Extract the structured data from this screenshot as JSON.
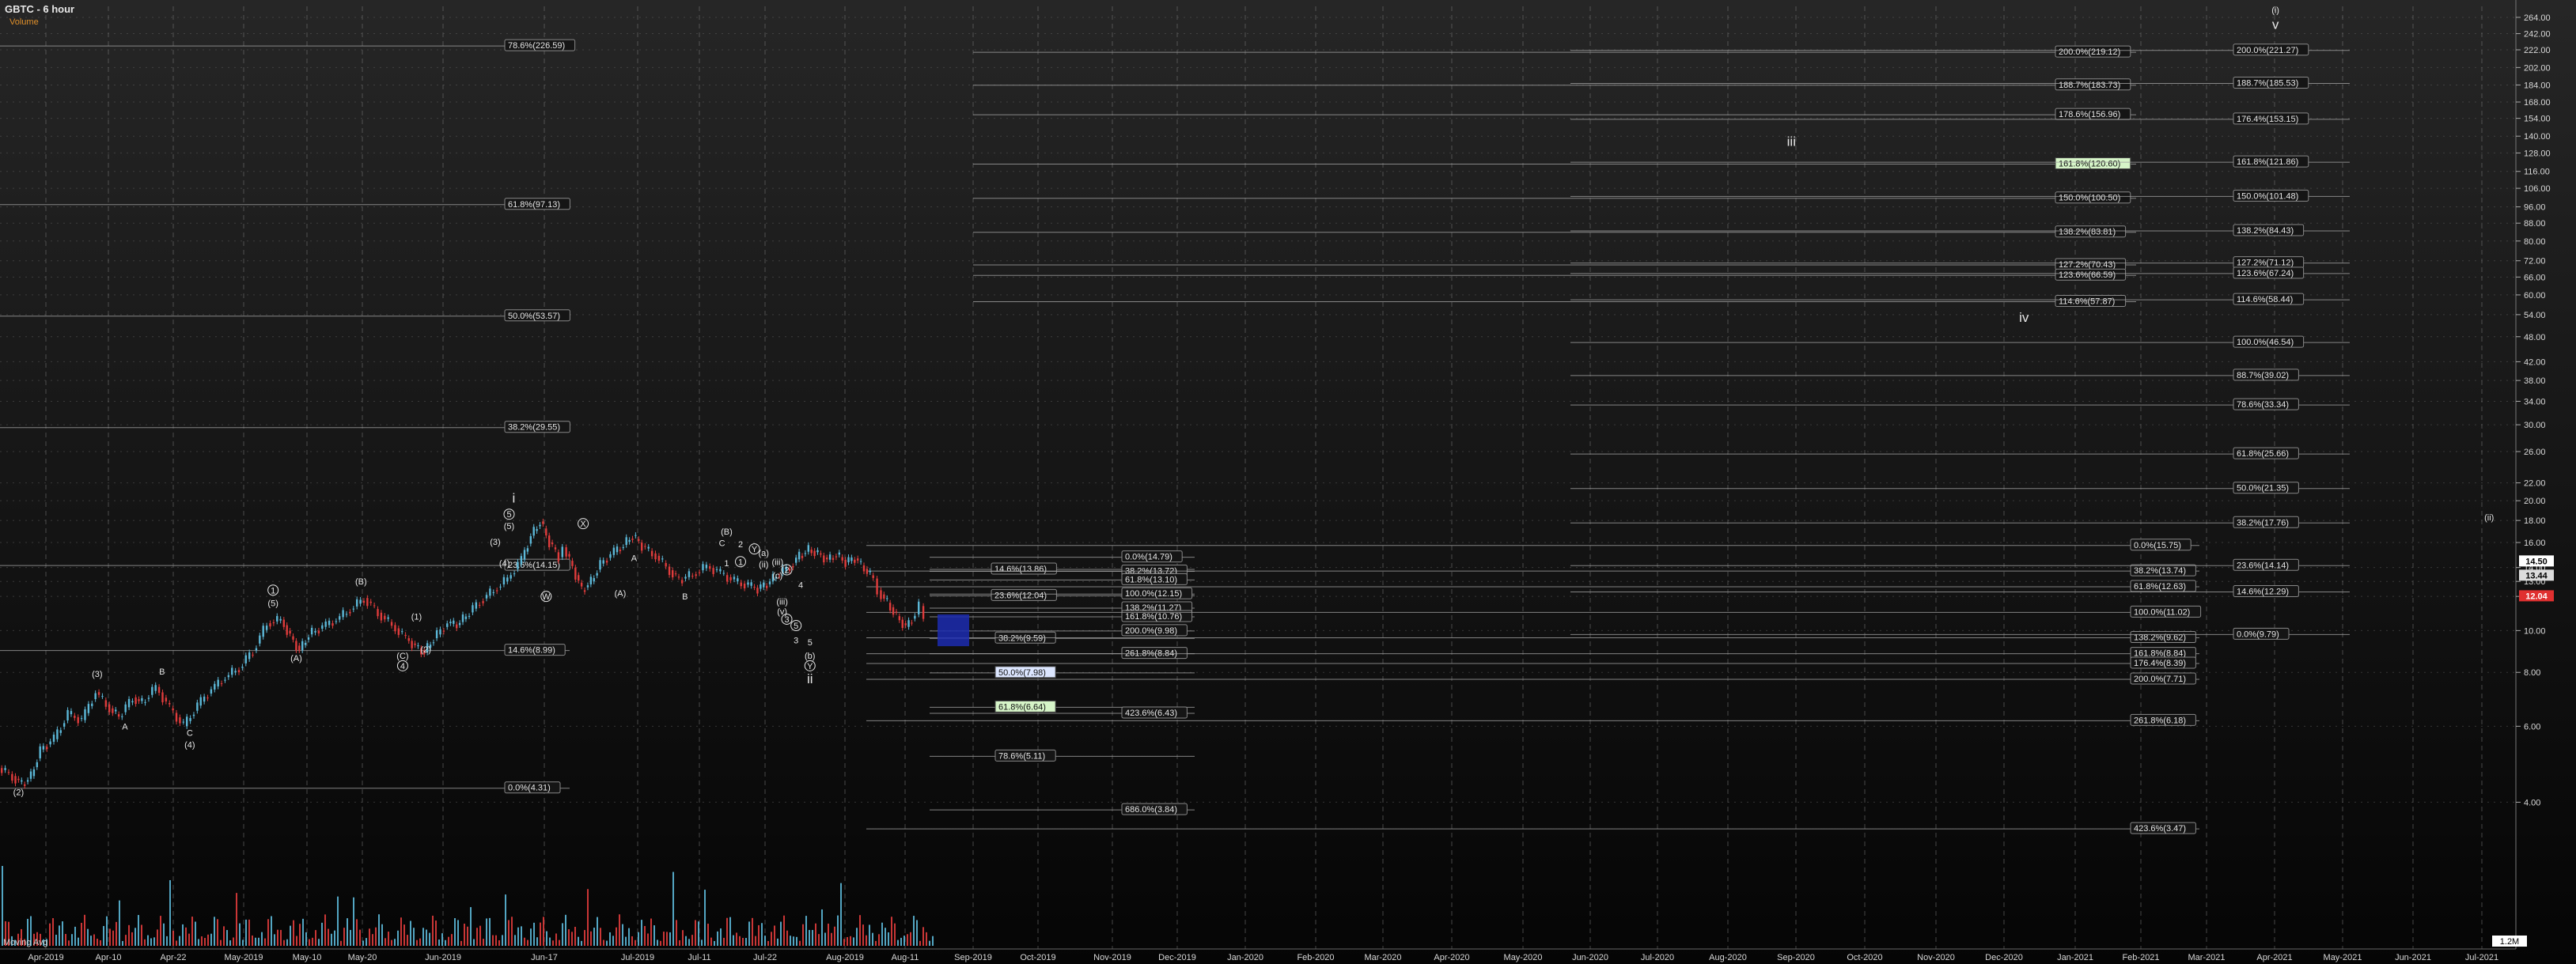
{
  "chart_data": {
    "type": "line",
    "title": "GBTC - 6 hour",
    "subtitle": "Volume",
    "volume_label": "Moving Avg",
    "volume_axis_label": "1.2M",
    "yscale": "log",
    "ylim": [
      3.3,
      280
    ],
    "grid": true,
    "colors": {
      "up": "#5cb8d8",
      "down": "#e03c3c",
      "bg_top": "#232323",
      "bg_bottom": "#050505",
      "fib_line": "#9a9a9a",
      "text": "#e6e6e6",
      "highlight_box": "#1c2cb0"
    },
    "x_labels": [
      "Apr-2019",
      "Apr-10",
      "Apr-22",
      "May-2019",
      "May-10",
      "May-20",
      "Jun-2019",
      "Jun-17",
      "Jul-2019",
      "Jul-11",
      "Jul-22",
      "Aug-2019",
      "Aug-11",
      "Sep-2019",
      "Oct-2019",
      "Nov-2019",
      "Dec-2019",
      "Jan-2020",
      "Feb-2020",
      "Mar-2020",
      "Apr-2020",
      "May-2020",
      "Jun-2020",
      "Jul-2020",
      "Aug-2020",
      "Sep-2020",
      "Oct-2020",
      "Nov-2020",
      "Dec-2020",
      "Jan-2021",
      "Feb-2021",
      "Mar-2021",
      "Apr-2021",
      "May-2021",
      "Jun-2021",
      "Jul-2021"
    ],
    "y_ticks": [
      "264.00",
      "242.00",
      "222.00",
      "202.00",
      "184.00",
      "168.00",
      "154.00",
      "140.00",
      "128.00",
      "116.00",
      "106.00",
      "96.00",
      "88.00",
      "80.00",
      "72.00",
      "66.00",
      "60.00",
      "54.00",
      "48.00",
      "42.00",
      "38.00",
      "34.00",
      "30.00",
      "26.00",
      "22.00",
      "20.00",
      "18.00",
      "16.00",
      "14.00",
      "13.00",
      "12.00",
      "10.00",
      "8.00",
      "6.00",
      "4.00"
    ],
    "y_tick_values": [
      264,
      242,
      222,
      202,
      184,
      168,
      154,
      140,
      128,
      116,
      106,
      96,
      88,
      80,
      72,
      66,
      60,
      54,
      48,
      42,
      38,
      34,
      30,
      26,
      22,
      20,
      18,
      16,
      14,
      13,
      12,
      10,
      8,
      6,
      4
    ],
    "price_badges": [
      {
        "label": "14.50",
        "value": 14.5,
        "color": "#ffffff",
        "text_color": "#000000"
      },
      {
        "label": "13.44",
        "value": 13.44,
        "color": "#dcdcdc",
        "text_color": "#000000"
      },
      {
        "label": "12.04",
        "value": 12.04,
        "color": "#e03030",
        "text_color": "#ffffff"
      }
    ],
    "price_path": [
      [
        0,
        4.8
      ],
      [
        3,
        4.6
      ],
      [
        5,
        4.4
      ],
      [
        7,
        4.6
      ],
      [
        9,
        5.3
      ],
      [
        12,
        5.6
      ],
      [
        15,
        6.4
      ],
      [
        18,
        6.2
      ],
      [
        21,
        7.2
      ],
      [
        24,
        6.6
      ],
      [
        26,
        6.3
      ],
      [
        29,
        7.0
      ],
      [
        31,
        6.8
      ],
      [
        34,
        7.4
      ],
      [
        37,
        6.6
      ],
      [
        40,
        6.0
      ],
      [
        43,
        6.7
      ],
      [
        46,
        7.3
      ],
      [
        49,
        7.8
      ],
      [
        52,
        8.2
      ],
      [
        55,
        9.0
      ],
      [
        58,
        10.4
      ],
      [
        61,
        10.6
      ],
      [
        63,
        9.7
      ],
      [
        65,
        9.0
      ],
      [
        67,
        9.8
      ],
      [
        70,
        10.2
      ],
      [
        73,
        10.6
      ],
      [
        76,
        11.2
      ],
      [
        79,
        11.9
      ],
      [
        82,
        11.0
      ],
      [
        85,
        10.3
      ],
      [
        88,
        9.6
      ],
      [
        90,
        9.2
      ],
      [
        92,
        8.9
      ],
      [
        94,
        9.6
      ],
      [
        97,
        10.4
      ],
      [
        99,
        10.3
      ],
      [
        101,
        10.8
      ],
      [
        104,
        11.7
      ],
      [
        107,
        12.4
      ],
      [
        110,
        13.2
      ],
      [
        113,
        14.6
      ],
      [
        115,
        16.6
      ],
      [
        117,
        17.9
      ],
      [
        119,
        16.0
      ],
      [
        121,
        14.8
      ],
      [
        122,
        15.6
      ],
      [
        124,
        14.0
      ],
      [
        126,
        12.4
      ],
      [
        128,
        13.0
      ],
      [
        130,
        14.3
      ],
      [
        133,
        15.2
      ],
      [
        135,
        15.8
      ],
      [
        137,
        16.6
      ],
      [
        139,
        15.7
      ],
      [
        142,
        14.9
      ],
      [
        145,
        13.8
      ],
      [
        147,
        13.1
      ],
      [
        150,
        13.5
      ],
      [
        153,
        14.1
      ],
      [
        156,
        13.6
      ],
      [
        159,
        13.0
      ],
      [
        162,
        12.7
      ],
      [
        164,
        12.5
      ],
      [
        166,
        12.8
      ],
      [
        168,
        13.4
      ],
      [
        171,
        14.1
      ],
      [
        173,
        14.9
      ],
      [
        175,
        15.4
      ],
      [
        177,
        15.1
      ],
      [
        179,
        14.6
      ],
      [
        181,
        15.0
      ],
      [
        183,
        14.4
      ],
      [
        185,
        14.7
      ],
      [
        187,
        13.9
      ],
      [
        189,
        13.2
      ],
      [
        190,
        12.4
      ],
      [
        192,
        11.6
      ],
      [
        194,
        10.8
      ],
      [
        196,
        10.2
      ],
      [
        198,
        10.9
      ],
      [
        199,
        11.4
      ],
      [
        200,
        10.4
      ]
    ],
    "price_x_start": 0,
    "price_x_end": 200,
    "fib_levels": [
      {
        "label": "78.6%(226.59)",
        "value": 226.59,
        "group": "a"
      },
      {
        "label": "61.8%(97.13)",
        "value": 97.13,
        "group": "a"
      },
      {
        "label": "50.0%(53.57)",
        "value": 53.57,
        "group": "a"
      },
      {
        "label": "38.2%(29.55)",
        "value": 29.55,
        "group": "a"
      },
      {
        "label": "23.6%(14.15)",
        "value": 14.15,
        "group": "a"
      },
      {
        "label": "14.6%(8.99)",
        "value": 8.99,
        "group": "a"
      },
      {
        "label": "0.0%(4.31)",
        "value": 4.31,
        "group": "a"
      },
      {
        "label": "0.0%(14.79)",
        "value": 14.79,
        "group": "b"
      },
      {
        "label": "14.6%(13.86)",
        "value": 13.86,
        "group": "b"
      },
      {
        "label": "38.2%(13.72)",
        "value": 13.72,
        "group": "b"
      },
      {
        "label": "61.8%(13.10)",
        "value": 13.1,
        "group": "b"
      },
      {
        "label": "23.6%(12.04)",
        "value": 12.04,
        "group": "b"
      },
      {
        "label": "100.0%(12.15)",
        "value": 12.15,
        "group": "b"
      },
      {
        "label": "138.2%(11.27)",
        "value": 11.27,
        "group": "b"
      },
      {
        "label": "161.8%(10.76)",
        "value": 10.76,
        "group": "b"
      },
      {
        "label": "200.0%(9.98)",
        "value": 9.98,
        "group": "b"
      },
      {
        "label": "38.2%(9.59)",
        "value": 9.59,
        "group": "b"
      },
      {
        "label": "261.8%(8.84)",
        "value": 8.84,
        "group": "b"
      },
      {
        "label": "50.0%(7.98)",
        "value": 7.98,
        "group": "b",
        "badge": "#dce6ff"
      },
      {
        "label": "61.8%(6.64)",
        "value": 6.64,
        "group": "b",
        "badge": "#d6f5c8"
      },
      {
        "label": "423.6%(6.43)",
        "value": 6.43,
        "group": "b"
      },
      {
        "label": "78.6%(5.11)",
        "value": 5.11,
        "group": "b"
      },
      {
        "label": "686.0%(3.84)",
        "value": 3.84,
        "group": "b"
      },
      {
        "label": "200.0%(219.12)",
        "value": 219.12,
        "group": "c"
      },
      {
        "label": "188.7%(183.73)",
        "value": 183.73,
        "group": "c"
      },
      {
        "label": "178.6%(156.96)",
        "value": 156.96,
        "group": "c"
      },
      {
        "label": "161.8%(120.60)",
        "value": 120.6,
        "group": "c",
        "badge": "#d6f5c8"
      },
      {
        "label": "150.0%(100.50)",
        "value": 100.5,
        "group": "c"
      },
      {
        "label": "138.2%(83.81)",
        "value": 83.81,
        "group": "c"
      },
      {
        "label": "127.2%(70.43)",
        "value": 70.43,
        "group": "c"
      },
      {
        "label": "123.6%(66.59)",
        "value": 66.59,
        "group": "c"
      },
      {
        "label": "114.6%(57.87)",
        "value": 57.87,
        "group": "c"
      },
      {
        "label": "0.0%(15.75)",
        "value": 15.75,
        "group": "d"
      },
      {
        "label": "38.2%(13.74)",
        "value": 13.74,
        "group": "d"
      },
      {
        "label": "61.8%(12.63)",
        "value": 12.63,
        "group": "d"
      },
      {
        "label": "100.0%(11.02)",
        "value": 11.02,
        "group": "d"
      },
      {
        "label": "138.2%(9.62)",
        "value": 9.62,
        "group": "d"
      },
      {
        "label": "161.8%(8.84)",
        "value": 8.84,
        "group": "d"
      },
      {
        "label": "176.4%(8.39)",
        "value": 8.39,
        "group": "d"
      },
      {
        "label": "200.0%(7.71)",
        "value": 7.71,
        "group": "d"
      },
      {
        "label": "261.8%(6.18)",
        "value": 6.18,
        "group": "d"
      },
      {
        "label": "423.6%(3.47)",
        "value": 3.47,
        "group": "d"
      },
      {
        "label": "200.0%(221.27)",
        "value": 221.27,
        "group": "e"
      },
      {
        "label": "188.7%(185.53)",
        "value": 185.53,
        "group": "e"
      },
      {
        "label": "176.4%(153.15)",
        "value": 153.15,
        "group": "e"
      },
      {
        "label": "161.8%(121.86)",
        "value": 121.86,
        "group": "e"
      },
      {
        "label": "150.0%(101.48)",
        "value": 101.48,
        "group": "e"
      },
      {
        "label": "138.2%(84.43)",
        "value": 84.43,
        "group": "e"
      },
      {
        "label": "127.2%(71.12)",
        "value": 71.12,
        "group": "e"
      },
      {
        "label": "123.6%(67.24)",
        "value": 67.24,
        "group": "e"
      },
      {
        "label": "114.6%(58.44)",
        "value": 58.44,
        "group": "e"
      },
      {
        "label": "100.0%(46.54)",
        "value": 46.54,
        "group": "e"
      },
      {
        "label": "88.7%(39.02)",
        "value": 39.02,
        "group": "e"
      },
      {
        "label": "78.6%(33.34)",
        "value": 33.34,
        "group": "e"
      },
      {
        "label": "61.8%(25.66)",
        "value": 25.66,
        "group": "e"
      },
      {
        "label": "50.0%(21.35)",
        "value": 21.35,
        "group": "e"
      },
      {
        "label": "38.2%(17.76)",
        "value": 17.76,
        "group": "e"
      },
      {
        "label": "23.6%(14.14)",
        "value": 14.14,
        "group": "e"
      },
      {
        "label": "14.6%(12.29)",
        "value": 12.29,
        "group": "e"
      },
      {
        "label": "0.0%(9.79)",
        "value": 9.79,
        "group": "e"
      }
    ],
    "wave_labels": [
      {
        "text": "(2)",
        "x": 4,
        "value": 4.15
      },
      {
        "text": "(3)",
        "x": 21,
        "value": 7.8
      },
      {
        "text": "A",
        "x": 27,
        "value": 5.9
      },
      {
        "text": "B",
        "x": 35,
        "value": 7.9
      },
      {
        "text": "C",
        "x": 41,
        "value": 5.7
      },
      {
        "text": "(4)",
        "x": 41,
        "value": 5.35
      },
      {
        "text": "1",
        "x": 59,
        "value": 12.2,
        "circled": true
      },
      {
        "text": "(5)",
        "x": 59,
        "value": 11.4
      },
      {
        "text": "(A)",
        "x": 64,
        "value": 8.5
      },
      {
        "text": "(B)",
        "x": 78,
        "value": 12.8
      },
      {
        "text": "(1)",
        "x": 90,
        "value": 10.6
      },
      {
        "text": "(2)",
        "x": 92,
        "value": 8.9
      },
      {
        "text": "(C)",
        "x": 87,
        "value": 8.6
      },
      {
        "text": "4",
        "x": 87,
        "value": 8.15,
        "circled": true
      },
      {
        "text": "(3)",
        "x": 107,
        "value": 15.8
      },
      {
        "text": "(4)",
        "x": 109,
        "value": 14.1
      },
      {
        "text": "(5)",
        "x": 110,
        "value": 17.2
      },
      {
        "text": "5",
        "x": 110,
        "value": 18.3,
        "circled": true
      },
      {
        "text": "i",
        "x": 111,
        "value": 19.8
      },
      {
        "text": "W",
        "x": 118,
        "value": 11.8,
        "circled": true
      },
      {
        "text": "X",
        "x": 126,
        "value": 17.4,
        "circled": true
      },
      {
        "text": "(A)",
        "x": 134,
        "value": 12.0
      },
      {
        "text": "A",
        "x": 137,
        "value": 14.5
      },
      {
        "text": "B",
        "x": 148,
        "value": 11.8
      },
      {
        "text": "(B)",
        "x": 157,
        "value": 16.7
      },
      {
        "text": "C",
        "x": 156,
        "value": 15.7
      },
      {
        "text": "2",
        "x": 160,
        "value": 15.6
      },
      {
        "text": "Y",
        "x": 163,
        "value": 15.2,
        "circled": true
      },
      {
        "text": "(a)",
        "x": 165,
        "value": 14.9
      },
      {
        "text": "1",
        "x": 157,
        "value": 14.1
      },
      {
        "text": "1",
        "x": 160,
        "value": 14.2,
        "circled": true
      },
      {
        "text": "(ii)",
        "x": 165,
        "value": 14.0
      },
      {
        "text": "(iii)",
        "x": 168,
        "value": 14.2
      },
      {
        "text": "2",
        "x": 170,
        "value": 13.6,
        "circled": true
      },
      {
        "text": "(c)",
        "x": 168,
        "value": 13.2
      },
      {
        "text": "4",
        "x": 173,
        "value": 12.55
      },
      {
        "text": "(iii)",
        "x": 169,
        "value": 11.5
      },
      {
        "text": "(v)",
        "x": 169,
        "value": 10.9
      },
      {
        "text": "3",
        "x": 170,
        "value": 10.45,
        "circled": true
      },
      {
        "text": "5",
        "x": 172,
        "value": 10.1,
        "circled": true
      },
      {
        "text": "3",
        "x": 172,
        "value": 9.35
      },
      {
        "text": "5",
        "x": 175,
        "value": 9.25
      },
      {
        "text": "(b)",
        "x": 175,
        "value": 8.6
      },
      {
        "text": "Y",
        "x": 175,
        "value": 8.15,
        "circled": true
      },
      {
        "text": "ii",
        "x": 175,
        "value": 7.55
      },
      {
        "text": "(ii)",
        "x": 396,
        "value": 18.0
      },
      {
        "text": "iii",
        "x": 285,
        "value": 133
      },
      {
        "text": "iv",
        "x": 322,
        "value": 52
      },
      {
        "text": "(i)",
        "x": 362,
        "value": 270
      },
      {
        "text": "v",
        "x": 362,
        "value": 248
      }
    ]
  }
}
